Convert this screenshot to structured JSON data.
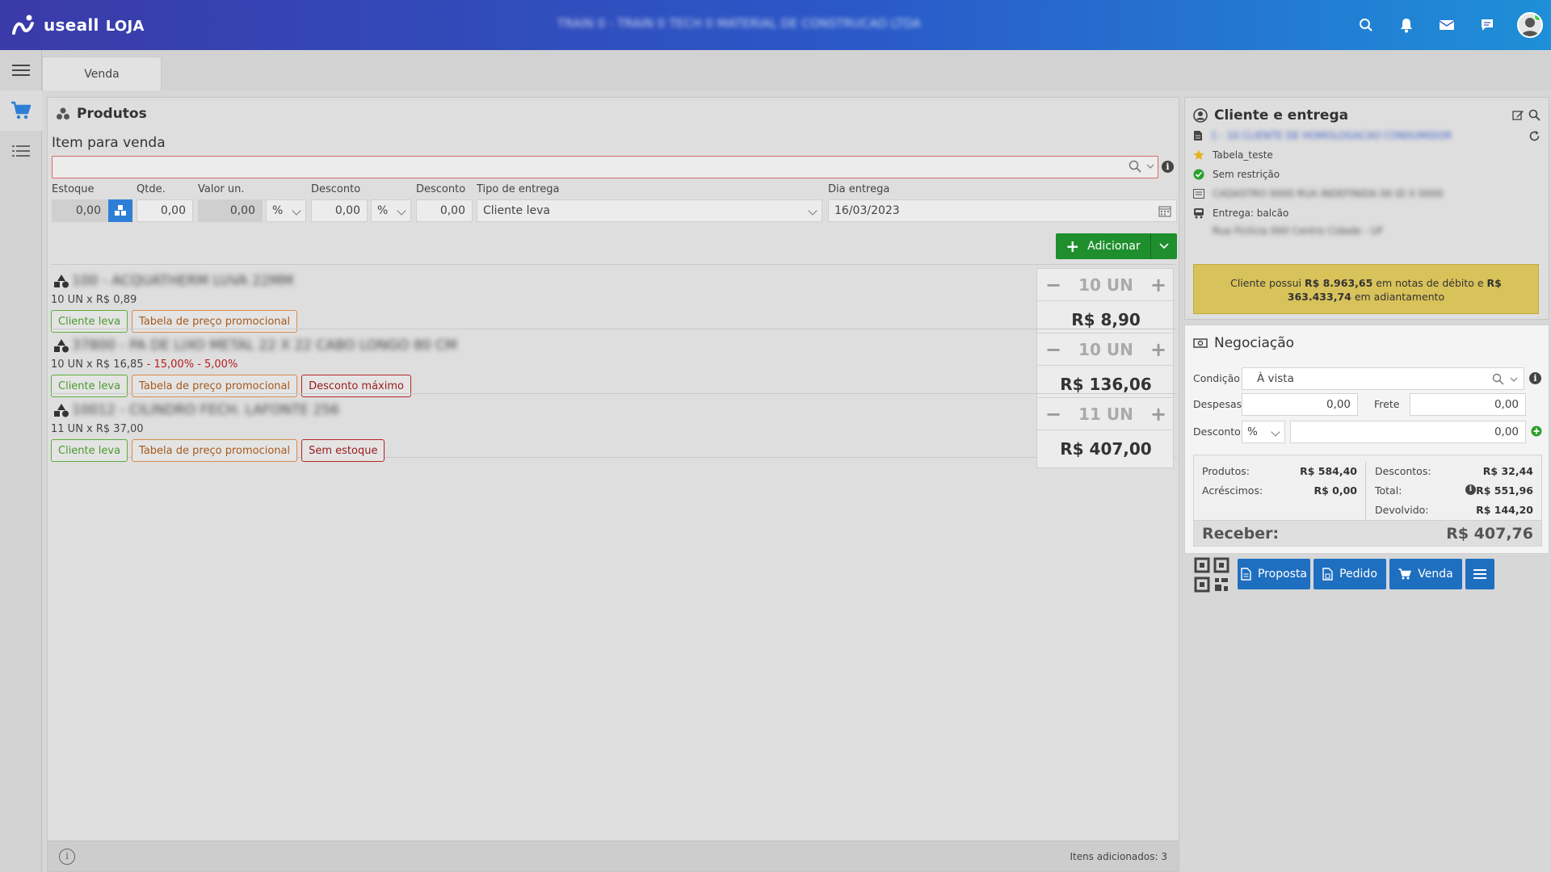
{
  "header": {
    "logo_text": "useall",
    "logo_suffix": "LOJA",
    "center_text": "TRAIN 0 - TRAIN 0 TECH 0 MATERIAL DE CONSTRUCAO LTDA"
  },
  "tabs": [
    {
      "label": "Venda"
    }
  ],
  "products": {
    "title": "Produtos",
    "item_label": "Item para venda",
    "fields": {
      "estoque_label": "Estoque",
      "estoque_value": "0,00",
      "qtde_label": "Qtde.",
      "qtde_value": "0,00",
      "valor_label": "Valor un.",
      "valor_value": "0,00",
      "desconto1_label": "Desconto",
      "desconto1_type": "%",
      "desconto1_value": "0,00",
      "desconto2_label": "Desconto",
      "desconto2_type": "%",
      "desconto2_value": "0,00",
      "tipo_label": "Tipo de entrega",
      "tipo_value": "Cliente leva",
      "dia_label": "Dia entrega",
      "dia_value": "16/03/2023"
    },
    "add_button": "Adicionar",
    "items": [
      {
        "name": "100 - ACQUATHERM LUVA 22MM",
        "qty_line": "10 UN x R$ 0,89",
        "discount_line": "",
        "tags": [
          "Cliente leva",
          "Tabela de preço promocional"
        ],
        "qty": "10 UN",
        "price": "R$ 8,90"
      },
      {
        "name": "37800 - PA DE LIXO METAL 22 X 22 CABO LONGO 80 CM",
        "qty_line": "10 UN x R$ 16,85",
        "discount_line": " - 15,00% - 5,00%",
        "tags": [
          "Cliente leva",
          "Tabela de preço promocional",
          "Desconto máximo"
        ],
        "qty": "10 UN",
        "price": "R$ 136,06"
      },
      {
        "name": "10012 - CILINDRO FECH. LAFONTE 256",
        "qty_line": "11 UN x R$ 37,00",
        "discount_line": "",
        "tags": [
          "Cliente leva",
          "Tabela de preço promocional",
          "Sem estoque"
        ],
        "qty": "11 UN",
        "price": "R$ 407,00"
      }
    ],
    "footer_text": "Itens adicionados: 3"
  },
  "client": {
    "title": "Cliente e entrega",
    "name": "1 - 10 CLIENTE DE HOMOLOGACAO CONSUMIDOR",
    "price_table": "Tabela_teste",
    "restriction": "Sem restrição",
    "address": "CADASTRO 0000 RUA INDEFINIDA 00 ID X 0000",
    "delivery": "Entrega: balcão",
    "delivery_address": "Rua Fictícia 000 Centro Cidade - UF",
    "warning_prefix": "Cliente possui ",
    "warning_debit": "R$ 8.963,65",
    "warning_middle": " em notas de débito e ",
    "warning_advance": "R$ 363.433,74",
    "warning_suffix": " em adiantamento"
  },
  "negotiation": {
    "title": "Negociação",
    "condicao_label": "Condição",
    "condicao_value": "À vista",
    "despesas_label": "Despesas",
    "despesas_value": "0,00",
    "frete_label": "Frete",
    "frete_value": "0,00",
    "desconto_label": "Desconto",
    "desconto_type": "%",
    "desconto_value": "0,00",
    "produtos_label": "Produtos:",
    "produtos_value": "R$ 584,40",
    "acrescimos_label": "Acréscimos:",
    "acrescimos_value": "R$ 0,00",
    "descontos_label": "Descontos:",
    "descontos_value": "R$ 32,44",
    "total_label": "Total:",
    "total_value": "R$ 551,96",
    "devolvido_label": "Devolvido:",
    "devolvido_value": "R$ 144,20",
    "receber_label": "Receber:",
    "receber_value": "R$ 407,76"
  },
  "actions": {
    "proposta": "Proposta",
    "pedido": "Pedido",
    "venda": "Venda"
  },
  "colors": {
    "primary": "#1f6fc0",
    "success": "#1f8f2e",
    "warning": "#d8c25a"
  }
}
